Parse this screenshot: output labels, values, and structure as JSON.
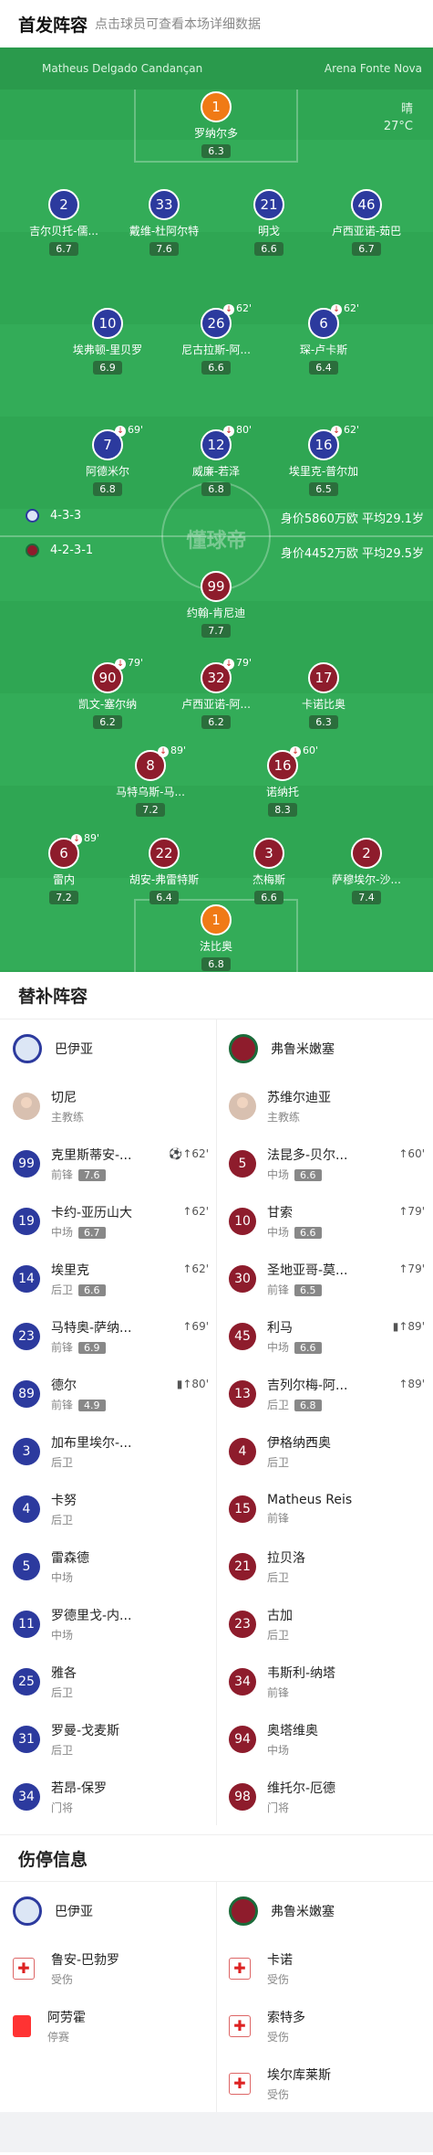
{
  "header": {
    "title": "首发阵容",
    "subtitle": "点击球员可查看本场详细数据"
  },
  "venue": {
    "referee": "Matheus Delgado Candançan",
    "stadium": "Arena Fonte Nova"
  },
  "weather": {
    "condition": "晴",
    "temp": "27°C"
  },
  "watermark": "懂球帝",
  "home_formation": "4-3-3",
  "home_value": "身价5860万欧 平均29.1岁",
  "away_formation": "4-2-3-1",
  "away_value": "身价4452万欧 平均29.5岁",
  "home_players": [
    {
      "num": "1",
      "name": "罗纳尔多",
      "score": "6.3",
      "ev": ""
    },
    {
      "num": "2",
      "name": "吉尔贝托-儒...",
      "score": "6.7",
      "ev": ""
    },
    {
      "num": "33",
      "name": "戴维-杜阿尔特",
      "score": "7.6",
      "ev": ""
    },
    {
      "num": "21",
      "name": "明戈",
      "score": "6.6",
      "ev": ""
    },
    {
      "num": "46",
      "name": "卢西亚诺-茹巴",
      "score": "6.7",
      "ev": ""
    },
    {
      "num": "10",
      "name": "埃弗顿-里贝罗",
      "score": "6.9",
      "ev": ""
    },
    {
      "num": "26",
      "name": "尼古拉斯-阿...",
      "score": "6.6",
      "ev": "62'"
    },
    {
      "num": "6",
      "name": "琛-卢卡斯",
      "score": "6.4",
      "ev": "62'"
    },
    {
      "num": "7",
      "name": "阿德米尔",
      "score": "6.8",
      "ev": "69'"
    },
    {
      "num": "12",
      "name": "威廉-若泽",
      "score": "6.8",
      "ev": "80'"
    },
    {
      "num": "16",
      "name": "埃里克-普尔加",
      "score": "6.5",
      "ev": "62'"
    }
  ],
  "away_players": [
    {
      "num": "99",
      "name": "约翰-肯尼迪",
      "score": "7.7",
      "ev": ""
    },
    {
      "num": "90",
      "name": "凯文-塞尔纳",
      "score": "6.2",
      "ev": "79'"
    },
    {
      "num": "32",
      "name": "卢西亚诺-阿...",
      "score": "6.2",
      "ev": "79'"
    },
    {
      "num": "17",
      "name": "卡诺比奥",
      "score": "6.3",
      "ev": ""
    },
    {
      "num": "8",
      "name": "马特乌斯-马...",
      "score": "7.2",
      "ev": "89'"
    },
    {
      "num": "16",
      "name": "诺纳托",
      "score": "8.3",
      "ev": "60'"
    },
    {
      "num": "6",
      "name": "雷内",
      "score": "7.2",
      "ev": "89'"
    },
    {
      "num": "22",
      "name": "胡安-弗雷特斯",
      "score": "6.4",
      "ev": ""
    },
    {
      "num": "3",
      "name": "杰梅斯",
      "score": "6.6",
      "ev": ""
    },
    {
      "num": "2",
      "name": "萨穆埃尔-沙...",
      "score": "7.4",
      "ev": ""
    },
    {
      "num": "1",
      "name": "法比奥",
      "score": "6.8",
      "ev": ""
    }
  ],
  "subs_title": "替补阵容",
  "home_team": "巴伊亚",
  "away_team": "弗鲁米嫩塞",
  "coaches": [
    {
      "name": "切尼",
      "role": "主教练"
    },
    {
      "name": "苏维尔迪亚",
      "role": "主教练"
    }
  ],
  "subs_home": [
    {
      "num": "99",
      "name": "克里斯蒂安-...",
      "pos": "前锋",
      "score": "7.6",
      "ev": "⚽↑62'"
    },
    {
      "num": "19",
      "name": "卡约-亚历山大",
      "pos": "中场",
      "score": "6.7",
      "ev": "↑62'"
    },
    {
      "num": "14",
      "name": "埃里克",
      "pos": "后卫",
      "score": "6.6",
      "ev": "↑62'"
    },
    {
      "num": "23",
      "name": "马特奥-萨纳...",
      "pos": "前锋",
      "score": "6.9",
      "ev": "↑69'"
    },
    {
      "num": "89",
      "name": "德尔",
      "pos": "前锋",
      "score": "4.9",
      "ev": "▮↑80'"
    },
    {
      "num": "3",
      "name": "加布里埃尔-...",
      "pos": "后卫",
      "score": "",
      "ev": ""
    },
    {
      "num": "4",
      "name": "卡努",
      "pos": "后卫",
      "score": "",
      "ev": ""
    },
    {
      "num": "5",
      "name": "雷森德",
      "pos": "中场",
      "score": "",
      "ev": ""
    },
    {
      "num": "11",
      "name": "罗德里戈-内...",
      "pos": "中场",
      "score": "",
      "ev": ""
    },
    {
      "num": "25",
      "name": "雅各",
      "pos": "后卫",
      "score": "",
      "ev": ""
    },
    {
      "num": "31",
      "name": "罗曼-戈麦斯",
      "pos": "后卫",
      "score": "",
      "ev": ""
    },
    {
      "num": "34",
      "name": "若昂-保罗",
      "pos": "门将",
      "score": "",
      "ev": ""
    }
  ],
  "subs_away": [
    {
      "num": "5",
      "name": "法昆多-贝尔...",
      "pos": "中场",
      "score": "6.6",
      "ev": "↑60'"
    },
    {
      "num": "10",
      "name": "甘索",
      "pos": "中场",
      "score": "6.6",
      "ev": "↑79'"
    },
    {
      "num": "30",
      "name": "圣地亚哥-莫...",
      "pos": "前锋",
      "score": "6.5",
      "ev": "↑79'"
    },
    {
      "num": "45",
      "name": "利马",
      "pos": "中场",
      "score": "6.6",
      "ev": "▮↑89'"
    },
    {
      "num": "13",
      "name": "吉列尔梅-阿...",
      "pos": "后卫",
      "score": "6.8",
      "ev": "↑89'"
    },
    {
      "num": "4",
      "name": "伊格纳西奥",
      "pos": "后卫",
      "score": "",
      "ev": ""
    },
    {
      "num": "15",
      "name": "Matheus Reis",
      "pos": "前锋",
      "score": "",
      "ev": ""
    },
    {
      "num": "21",
      "name": "拉贝洛",
      "pos": "后卫",
      "score": "",
      "ev": ""
    },
    {
      "num": "23",
      "name": "古加",
      "pos": "后卫",
      "score": "",
      "ev": ""
    },
    {
      "num": "34",
      "name": "韦斯利-纳塔",
      "pos": "前锋",
      "score": "",
      "ev": ""
    },
    {
      "num": "94",
      "name": "奥塔维奥",
      "pos": "中场",
      "score": "",
      "ev": ""
    },
    {
      "num": "98",
      "name": "维托尔-厄德",
      "pos": "门将",
      "score": "",
      "ev": ""
    }
  ],
  "injury_title": "伤停信息",
  "inj_home": [
    {
      "name": "鲁安-巴勃罗",
      "status": "受伤",
      "type": "injury"
    },
    {
      "name": "阿劳霍",
      "status": "停赛",
      "type": "card"
    }
  ],
  "inj_away": [
    {
      "name": "卡诺",
      "status": "受伤",
      "type": "injury"
    },
    {
      "name": "索特多",
      "status": "受伤",
      "type": "injury"
    },
    {
      "name": "埃尔库莱斯",
      "status": "受伤",
      "type": "injury"
    }
  ]
}
